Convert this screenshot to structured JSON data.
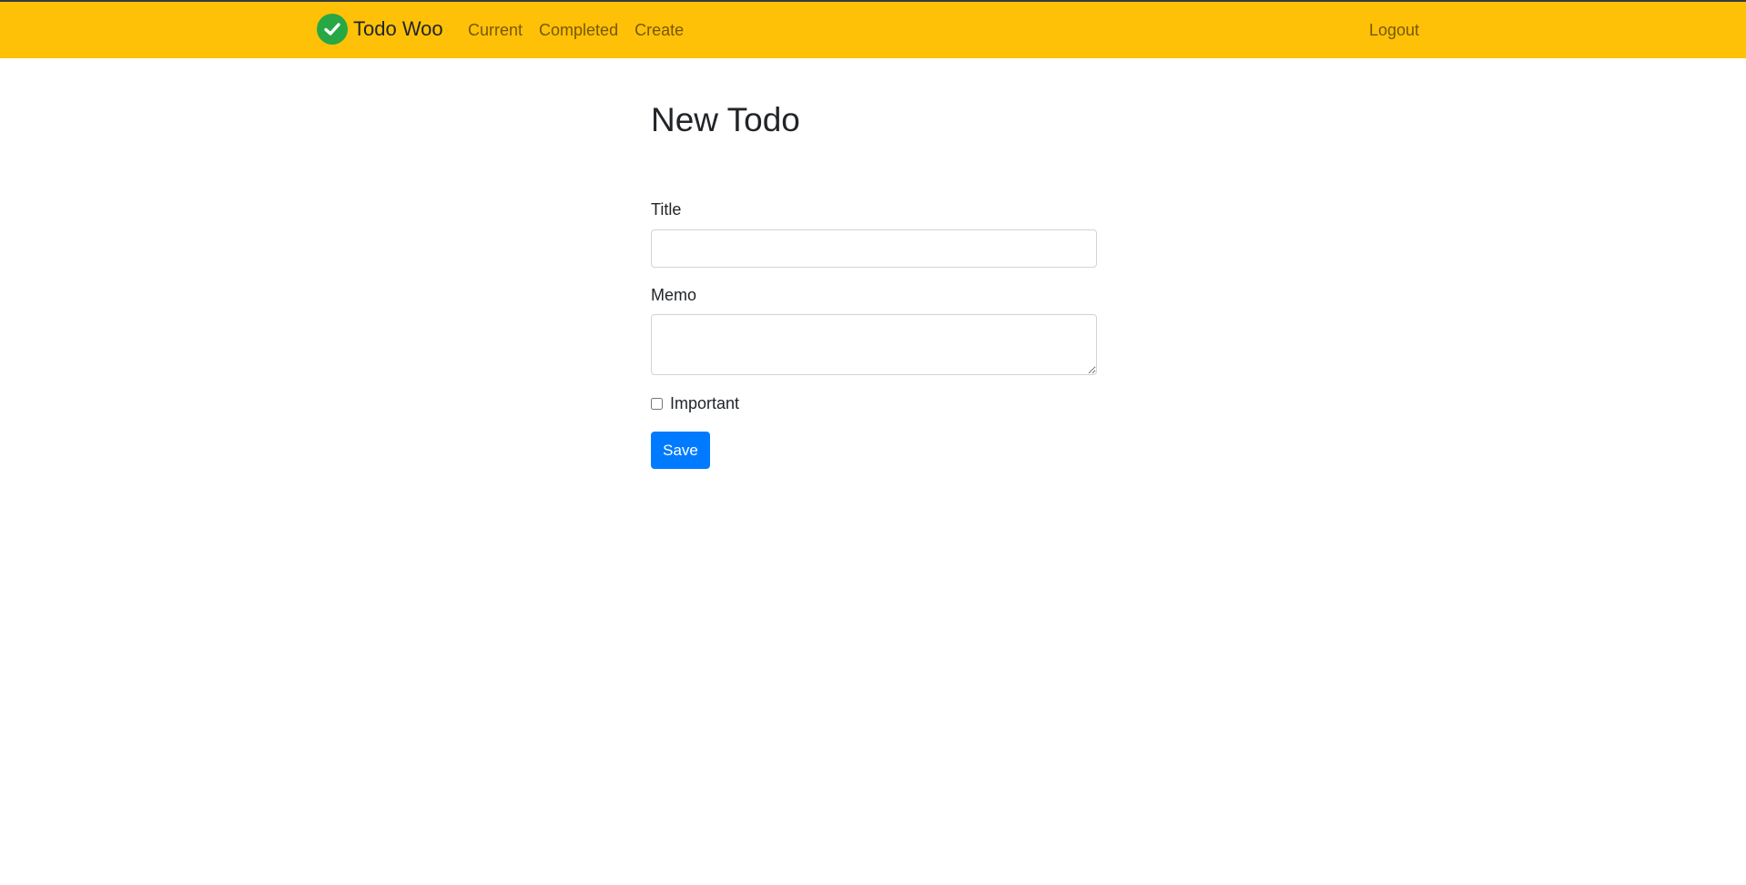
{
  "navbar": {
    "brand": {
      "icon": "check-circle-icon",
      "label": "Todo Woo",
      "icon_bg_color": "#28a745"
    },
    "links": [
      {
        "label": "Current"
      },
      {
        "label": "Completed"
      },
      {
        "label": "Create"
      }
    ],
    "logout_label": "Logout",
    "background_color": "#ffc107"
  },
  "main": {
    "title": "New Todo",
    "form": {
      "title_label": "Title",
      "title_value": "",
      "memo_label": "Memo",
      "memo_value": "",
      "important_label": "Important",
      "important_checked": false,
      "save_label": "Save",
      "save_color": "#007bff"
    }
  }
}
